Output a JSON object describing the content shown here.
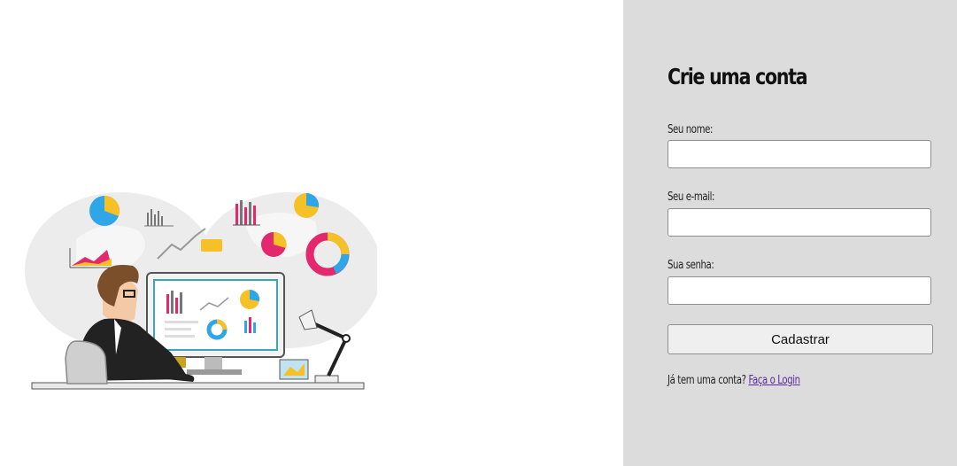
{
  "illustration": {
    "name": "analyst-at-computer-illustration",
    "colors": {
      "yellow": "#f6c027",
      "blue": "#2ea6e8",
      "pink": "#e3286e",
      "gray": "#e9e9e9"
    }
  },
  "form": {
    "title": "Crie uma conta",
    "name_label": "Seu nome:",
    "name_value": "",
    "email_label": "Seu e-mail:",
    "email_value": "",
    "password_label": "Sua senha:",
    "password_value": "",
    "submit_label": "Cadastrar",
    "footer_text": "Já tem uma conta?",
    "login_link": "Faça o Login"
  },
  "colors": {
    "panel_bg": "#dcdcdc",
    "link": "#5a2aa0"
  }
}
